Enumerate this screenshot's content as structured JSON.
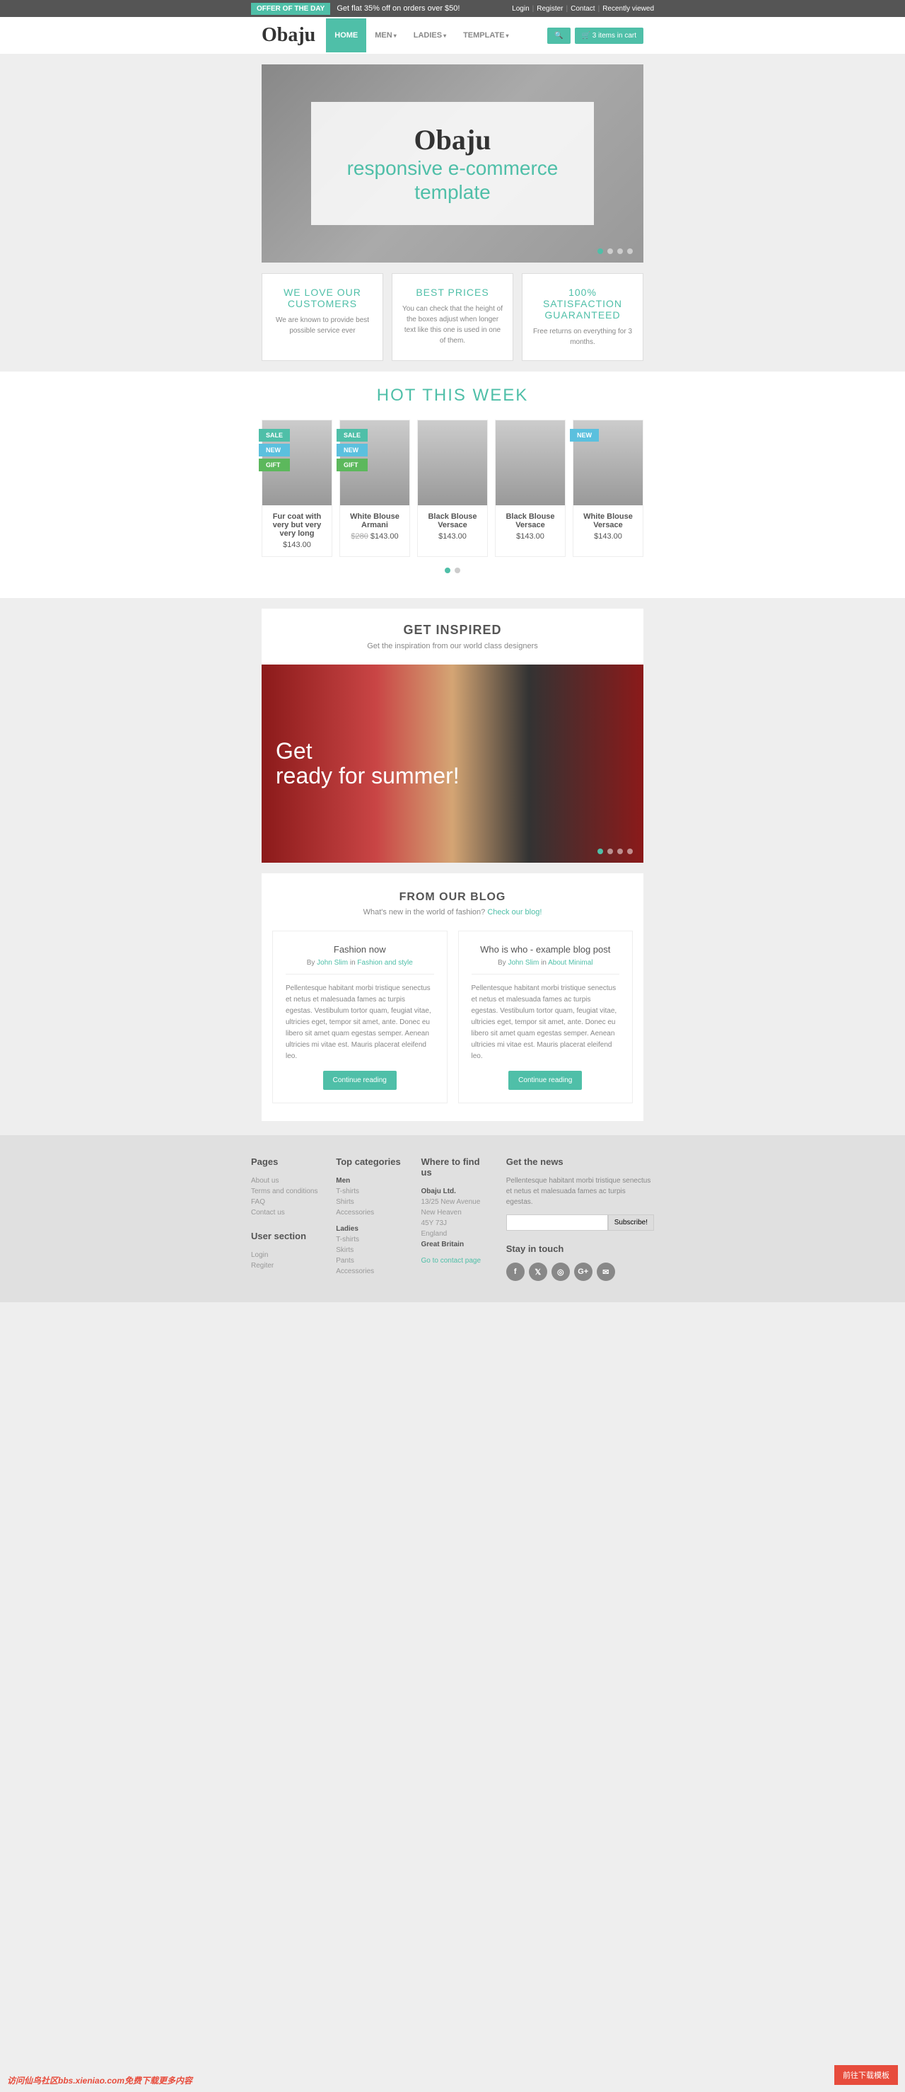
{
  "topbar": {
    "offer_badge": "OFFER OF THE DAY",
    "offer_text": "Get flat 35% off on orders over $50!",
    "links": [
      "Login",
      "Register",
      "Contact",
      "Recently viewed"
    ]
  },
  "nav": {
    "logo": "Obaju",
    "items": [
      {
        "label": "HOME",
        "active": true
      },
      {
        "label": "MEN",
        "dropdown": true
      },
      {
        "label": "LADIES",
        "dropdown": true
      },
      {
        "label": "TEMPLATE",
        "dropdown": true
      }
    ],
    "cart_label": "3 items in cart"
  },
  "hero": {
    "title": "Obaju",
    "subtitle": "responsive e-commerce template"
  },
  "features": [
    {
      "title": "WE LOVE OUR CUSTOMERS",
      "text": "We are known to provide best possible service ever"
    },
    {
      "title": "BEST PRICES",
      "text": "You can check that the height of the boxes adjust when longer text like this one is used in one of them."
    },
    {
      "title": "100% SATISFACTION GUARANTEED",
      "text": "Free returns on everything for 3 months."
    }
  ],
  "hot_title": "HOT THIS WEEK",
  "products": [
    {
      "name": "Fur coat with very but very very long",
      "price": "$143.00",
      "badges": [
        "SALE",
        "NEW",
        "GIFT"
      ]
    },
    {
      "name": "White Blouse Armani",
      "price": "$143.00",
      "old_price": "$280",
      "badges": [
        "SALE",
        "NEW",
        "GIFT"
      ]
    },
    {
      "name": "Black Blouse Versace",
      "price": "$143.00",
      "badges": []
    },
    {
      "name": "Black Blouse Versace",
      "price": "$143.00",
      "badges": []
    },
    {
      "name": "White Blouse Versace",
      "price": "$143.00",
      "badges": [
        "NEW"
      ]
    }
  ],
  "inspired": {
    "title": "GET INSPIRED",
    "subtitle": "Get the inspiration from our world class designers",
    "banner_line1": "Get",
    "banner_line2": "ready for summer!"
  },
  "blog": {
    "title": "FROM OUR BLOG",
    "subtitle_prefix": "What's new in the world of fashion? ",
    "subtitle_link": "Check our blog!",
    "posts": [
      {
        "title": "Fashion now",
        "author": "John Slim",
        "category": "Fashion and style",
        "text": "Pellentesque habitant morbi tristique senectus et netus et malesuada fames ac turpis egestas. Vestibulum tortor quam, feugiat vitae, ultricies eget, tempor sit amet, ante. Donec eu libero sit amet quam egestas semper. Aenean ultricies mi vitae est. Mauris placerat eleifend leo.",
        "btn": "Continue reading"
      },
      {
        "title": "Who is who - example blog post",
        "author": "John Slim",
        "category": "About Minimal",
        "text": "Pellentesque habitant morbi tristique senectus et netus et malesuada fames ac turpis egestas. Vestibulum tortor quam, feugiat vitae, ultricies eget, tempor sit amet, ante. Donec eu libero sit amet quam egestas semper. Aenean ultricies mi vitae est. Mauris placerat eleifend leo.",
        "btn": "Continue reading"
      }
    ]
  },
  "footer": {
    "pages": {
      "title": "Pages",
      "items": [
        "About us",
        "Terms and conditions",
        "FAQ",
        "Contact us"
      ]
    },
    "user": {
      "title": "User section",
      "items": [
        "Login",
        "Regiter"
      ]
    },
    "topcat": {
      "title": "Top categories",
      "men": "Men",
      "men_items": [
        "T-shirts",
        "Shirts",
        "Accessories"
      ],
      "ladies": "Ladies",
      "ladies_items": [
        "T-shirts",
        "Skirts",
        "Pants",
        "Accessories"
      ]
    },
    "where": {
      "title": "Where to find us",
      "lines": [
        "Obaju Ltd.",
        "13/25 New Avenue",
        "New Heaven",
        "45Y 73J",
        "England",
        "Great Britain"
      ],
      "link": "Go to contact page"
    },
    "news": {
      "title": "Get the news",
      "text": "Pellentesque habitant morbi tristique senectus et netus et malesuada fames ac turpis egestas.",
      "btn": "Subscribe!"
    },
    "stay": {
      "title": "Stay in touch"
    }
  },
  "red_button": "前往下载模板",
  "watermark": "访问仙鸟社区bbs.xieniao.com免费下载更多内容"
}
